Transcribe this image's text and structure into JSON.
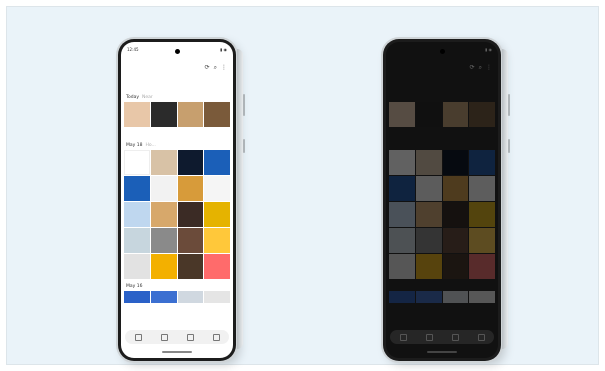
{
  "phones": [
    {
      "theme": "light",
      "status_time": "12:45",
      "toolbar_icons": [
        "refresh-icon",
        "search-icon",
        "more-icon"
      ],
      "sections": [
        {
          "label": "Today",
          "sub": "Near"
        },
        {
          "label": "May 18",
          "sub": "Ho..."
        },
        {
          "label": "May 16",
          "sub": ""
        }
      ],
      "nav_icons": [
        "pictures-icon",
        "albums-icon",
        "stories-icon",
        "menu-icon"
      ]
    },
    {
      "theme": "dark",
      "status_time": "",
      "toolbar_icons": [
        "refresh-icon",
        "search-icon",
        "more-icon"
      ],
      "sections": [
        {
          "label": "",
          "sub": ""
        },
        {
          "label": "",
          "sub": ""
        },
        {
          "label": "",
          "sub": ""
        }
      ],
      "nav_icons": [
        "pictures-icon",
        "albums-icon",
        "stories-icon",
        "menu-icon"
      ]
    }
  ],
  "palette": {
    "background": "#eaf3f9",
    "tiles": [
      "#e8c7a8",
      "#2b2b2b",
      "#c79f6e",
      "#7a5a3a",
      "#ffffff",
      "#d8c2a6",
      "#0e1a2e",
      "#1b5fb8",
      "#1b5fb8",
      "#f2f2f2",
      "#d79b3a",
      "#f5f5f5",
      "#bfd7ef",
      "#d7a86b",
      "#3b2b25",
      "#e5b300",
      "#c7d6de",
      "#8a8a8a",
      "#6b4b3a",
      "#ffc83a",
      "#e2e2e2",
      "#f3b000",
      "#4a3728",
      "#ff6b6b"
    ]
  }
}
